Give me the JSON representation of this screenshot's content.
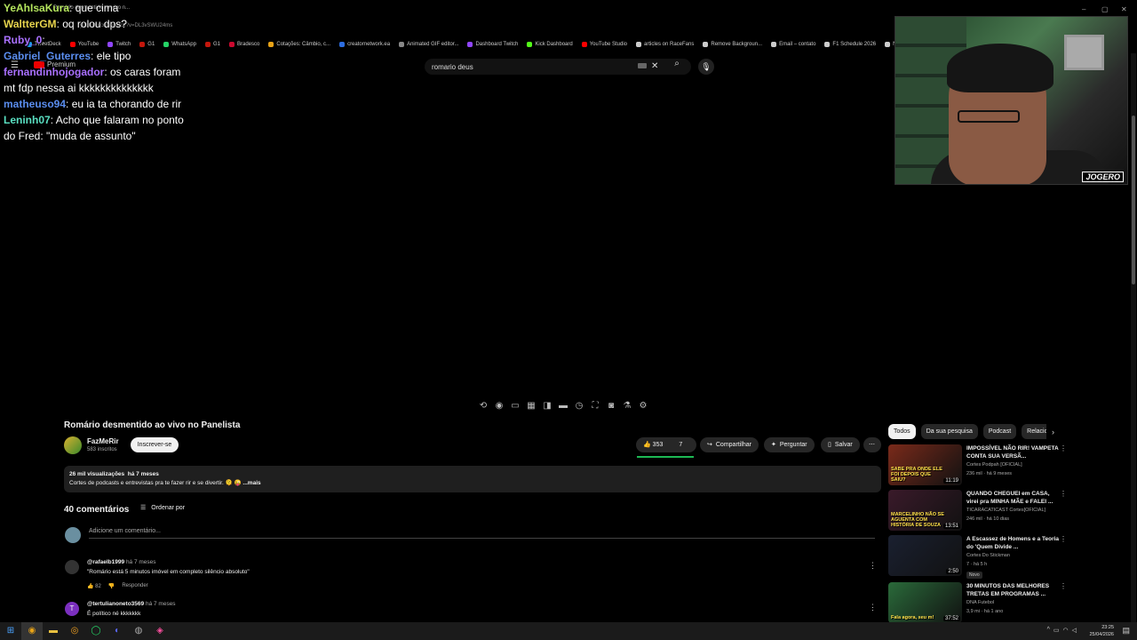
{
  "browser": {
    "tab_title": "Romário desmentido ao vivo n...",
    "url": "youtube.com/watch?v=DL3vSWU24ms",
    "bookmarks": [
      "TweetDeck",
      "YouTube",
      "Twitch",
      "G1",
      "WhatsApp",
      "G1",
      "Bradesco",
      "Cotações: Câmbio, c...",
      "creatornetwork.ea",
      "Animated GIF editor...",
      "Dashboard Twitch",
      "Kick Dashboard",
      "YouTube Studio",
      "articles on RaceFans",
      "Remove Backgroun...",
      "Email – contato",
      "F1 Schedule 2026",
      "Not"
    ],
    "bookmark_colors": [
      "#1d9bf0",
      "#ff0000",
      "#9146ff",
      "#c4170c",
      "#25d366",
      "#c4170c",
      "#cc092f",
      "#e8a317",
      "#2d6de0",
      "#888888",
      "#9146ff",
      "#53fc18",
      "#ff0000",
      "#cccccc",
      "#cccccc",
      "#cccccc",
      "#cccccc",
      "#cccccc"
    ]
  },
  "youtube_header": {
    "logo_text": "Premium",
    "search_value": "romario deus"
  },
  "chat": [
    {
      "user": "YeAhIsaKura",
      "user_color": "#b3e35d",
      "text": "que cima"
    },
    {
      "user": "WaltterGM",
      "user_color": "#e8d44d",
      "text": "oq rolou dps?"
    },
    {
      "user": "Ruby_0",
      "user_color": "#a970ff",
      "text": ""
    },
    {
      "user": "Gabriel_Guterres",
      "user_color": "#5a8dee",
      "text": "ele tipo"
    },
    {
      "user": "fernandinhojogador",
      "user_color": "#a970ff",
      "text": "os caras foram mt fdp nessa ai kkkkkkkkkkkkkk"
    },
    {
      "user": "matheuso94",
      "user_color": "#5a8dee",
      "text": "eu ia ta chorando de rir"
    },
    {
      "user": "Leninh07",
      "user_color": "#5ae0c2",
      "text": "Acho que falaram no ponto do Fred: \"muda de assunto\""
    }
  ],
  "webcam": {
    "tag": "JOGERO"
  },
  "video": {
    "title": "Romário desmentido ao vivo no Panelista",
    "channel": "FazMeRir",
    "subscribers": "583 inscritos",
    "subscribe_label": "Inscrever-se",
    "likes": "353",
    "dislikes": "7",
    "share_label": "Compartilhar",
    "ask_label": "Perguntar",
    "save_label": "Salvar",
    "views": "26 mil visualizações",
    "age": "há 7 meses",
    "description": "Cortes de podcasts e entrevistas pra te fazer rir e se divertir. 🫠 😜",
    "more_label": "...mais"
  },
  "comments": {
    "count_label": "40 comentários",
    "sort_label": "Ordenar por",
    "add_placeholder": "Adicione um comentário...",
    "items": [
      {
        "user": "@rafaelb1999",
        "time": "há 7 meses",
        "text": "\"Romário está 5 minutos imóvel em completo silêncio absoluto\"",
        "likes": "82",
        "reply": "Responder",
        "avatar_color": "#333333"
      },
      {
        "user": "@tertulianoneto3569",
        "time": "há 7 meses",
        "text": "É político né kkkkkkk",
        "likes": "",
        "reply": "",
        "avatar_color": "#7b2fbf",
        "initial": "T"
      }
    ]
  },
  "sidebar": {
    "chips": [
      "Todos",
      "Da sua pesquisa",
      "Podcast",
      "Relacionados"
    ],
    "recs": [
      {
        "title": "IMPOSSÍVEL NÃO RIR! VAMPETA CONTA SUA VERSÃ...",
        "channel": "Cortes Podpah [OFICIAL]",
        "meta": "236 mil · há 9 meses",
        "duration": "11:19",
        "thumb_text": "SABE PRA ONDE ELE FOI DEPOIS QUE SAIU?",
        "thumb_color": "#7a2a1a",
        "badge": ""
      },
      {
        "title": "QUANDO CHEGUEI em CASA, virei pra MINHA MÃE e FALEI ...",
        "channel": "TICARACATICAST Cortes[OFICIAL]",
        "meta": "246 mil · há 10 dias",
        "duration": "13:51",
        "thumb_text": "MARCELINHO NÃO SE AGUENTA COM HISTÓRIA DE SOUZA",
        "thumb_color": "#3a1a2a",
        "badge": ""
      },
      {
        "title": "A Escassez de Homens e a Teoria do 'Quem Divide ...",
        "channel": "Cortes Do Stickman",
        "meta": "7 · há 5 h",
        "duration": "2:50",
        "thumb_text": "",
        "thumb_color": "#1a2030",
        "badge": "Novo"
      },
      {
        "title": "30 MINUTOS DAS MELHORES TRETAS EM PROGRAMAS ...",
        "channel": "DNA Futebol",
        "meta": "3,9 mi · há 1 ano",
        "duration": "37:52",
        "thumb_text": "Fala agora, seu m!",
        "thumb_color": "#2a6a3a",
        "badge": ""
      }
    ]
  },
  "taskbar": {
    "time": "23:25",
    "date": "25/04/2026"
  }
}
